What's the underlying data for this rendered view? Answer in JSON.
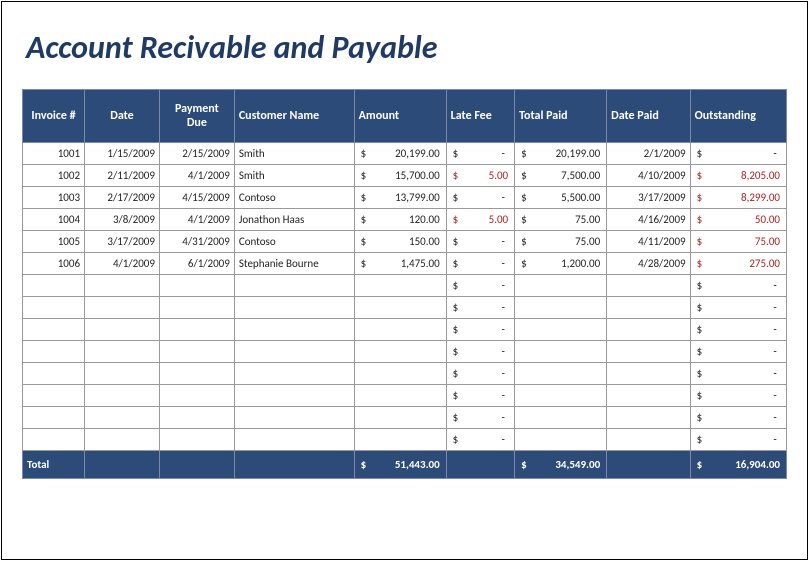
{
  "title": "Account Recivable and Payable",
  "headers": {
    "invoice": "Invoice #",
    "date": "Date",
    "payment_due": "Payment Due",
    "customer": "Customer Name",
    "amount": "Amount",
    "late_fee": "Late Fee",
    "total_paid": "Total Paid",
    "date_paid": "Date Paid",
    "outstanding": "Outstanding"
  },
  "currency_symbol": "$",
  "rows": [
    {
      "invoice": "1001",
      "date": "1/15/2009",
      "payment_due": "2/15/2009",
      "customer": "Smith",
      "amount": "20,199.00",
      "late_fee": "-",
      "total_paid": "20,199.00",
      "date_paid": "2/1/2009",
      "outstanding": "-",
      "outstanding_red": false
    },
    {
      "invoice": "1002",
      "date": "2/11/2009",
      "payment_due": "4/1/2009",
      "customer": "Smith",
      "amount": "15,700.00",
      "late_fee": "5.00",
      "late_fee_red": true,
      "total_paid": "7,500.00",
      "date_paid": "4/10/2009",
      "outstanding": "8,205.00",
      "outstanding_red": true
    },
    {
      "invoice": "1003",
      "date": "2/17/2009",
      "payment_due": "4/15/2009",
      "customer": "Contoso",
      "amount": "13,799.00",
      "late_fee": "-",
      "total_paid": "5,500.00",
      "date_paid": "3/17/2009",
      "outstanding": "8,299.00",
      "outstanding_red": true
    },
    {
      "invoice": "1004",
      "date": "3/8/2009",
      "payment_due": "4/1/2009",
      "customer": "Jonathon Haas",
      "amount": "120.00",
      "late_fee": "5.00",
      "late_fee_red": true,
      "total_paid": "75.00",
      "date_paid": "4/16/2009",
      "outstanding": "50.00",
      "outstanding_red": true
    },
    {
      "invoice": "1005",
      "date": "3/17/2009",
      "payment_due": "4/31/2009",
      "customer": "Contoso",
      "amount": "150.00",
      "late_fee": "-",
      "total_paid": "75.00",
      "date_paid": "4/11/2009",
      "outstanding": "75.00",
      "outstanding_red": true
    },
    {
      "invoice": "1006",
      "date": "4/1/2009",
      "payment_due": "6/1/2009",
      "customer": "Stephanie Bourne",
      "amount": "1,475.00",
      "late_fee": "-",
      "total_paid": "1,200.00",
      "date_paid": "4/28/2009",
      "outstanding": "275.00",
      "outstanding_red": true
    }
  ],
  "empty_row_count": 8,
  "totals": {
    "label": "Total",
    "amount": "51,443.00",
    "total_paid": "34,549.00",
    "outstanding": "16,904.00"
  },
  "chart_data": {
    "type": "table",
    "title": "Account Recivable and Payable",
    "columns": [
      "Invoice #",
      "Date",
      "Payment Due",
      "Customer Name",
      "Amount",
      "Late Fee",
      "Total Paid",
      "Date Paid",
      "Outstanding"
    ],
    "rows": [
      [
        "1001",
        "1/15/2009",
        "2/15/2009",
        "Smith",
        20199.0,
        null,
        20199.0,
        "2/1/2009",
        null
      ],
      [
        "1002",
        "2/11/2009",
        "4/1/2009",
        "Smith",
        15700.0,
        5.0,
        7500.0,
        "4/10/2009",
        8205.0
      ],
      [
        "1003",
        "2/17/2009",
        "4/15/2009",
        "Contoso",
        13799.0,
        null,
        5500.0,
        "3/17/2009",
        8299.0
      ],
      [
        "1004",
        "3/8/2009",
        "4/1/2009",
        "Jonathon Haas",
        120.0,
        5.0,
        75.0,
        "4/16/2009",
        50.0
      ],
      [
        "1005",
        "3/17/2009",
        "4/31/2009",
        "Contoso",
        150.0,
        null,
        75.0,
        "4/11/2009",
        75.0
      ],
      [
        "1006",
        "4/1/2009",
        "6/1/2009",
        "Stephanie Bourne",
        1475.0,
        null,
        1200.0,
        "4/28/2009",
        275.0
      ]
    ],
    "totals": {
      "Amount": 51443.0,
      "Total Paid": 34549.0,
      "Outstanding": 16904.0
    }
  }
}
